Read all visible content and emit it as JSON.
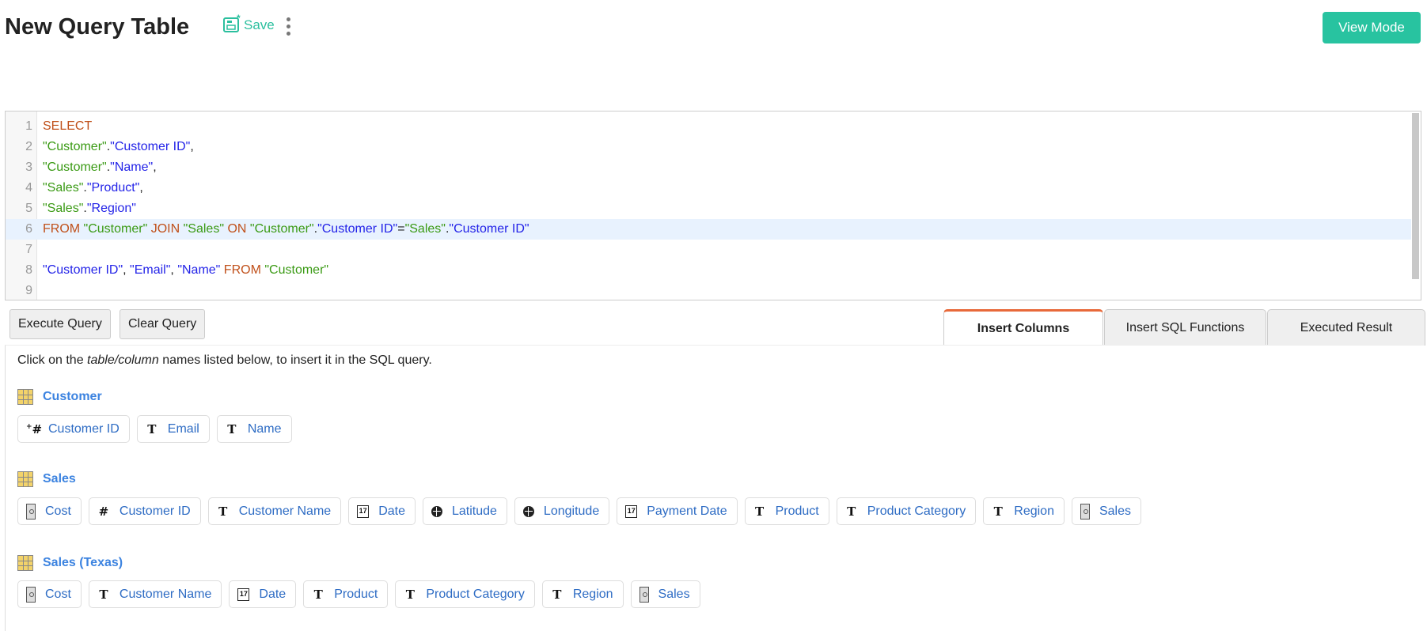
{
  "header": {
    "title": "New Query Table",
    "save_label": "Save",
    "view_mode_label": "View Mode"
  },
  "editor": {
    "lines": [
      {
        "n": "1",
        "tokens": [
          [
            "kw",
            "SELECT"
          ]
        ]
      },
      {
        "n": "2",
        "tokens": [
          [
            "tb",
            "\"Customer\""
          ],
          [
            "pn",
            "."
          ],
          [
            "cl",
            "\"Customer ID\""
          ],
          [
            "pn",
            ","
          ]
        ]
      },
      {
        "n": "3",
        "tokens": [
          [
            "tb",
            "\"Customer\""
          ],
          [
            "pn",
            "."
          ],
          [
            "cl",
            "\"Name\""
          ],
          [
            "pn",
            ","
          ]
        ]
      },
      {
        "n": "4",
        "tokens": [
          [
            "tb",
            "\"Sales\""
          ],
          [
            "pn",
            "."
          ],
          [
            "cl",
            "\"Product\""
          ],
          [
            "pn",
            ","
          ]
        ]
      },
      {
        "n": "5",
        "tokens": [
          [
            "tb",
            "\"Sales\""
          ],
          [
            "pn",
            "."
          ],
          [
            "cl",
            "\"Region\""
          ]
        ]
      },
      {
        "n": "6",
        "tokens": [
          [
            "kw",
            "FROM "
          ],
          [
            "tb",
            "\"Customer\""
          ],
          [
            "kw",
            " JOIN "
          ],
          [
            "tb",
            "\"Sales\""
          ],
          [
            "kw",
            " ON "
          ],
          [
            "tb",
            "\"Customer\""
          ],
          [
            "pn",
            "."
          ],
          [
            "cl",
            "\"Customer ID\""
          ],
          [
            "pn",
            "="
          ],
          [
            "tb",
            "\"Sales\""
          ],
          [
            "pn",
            "."
          ],
          [
            "cl",
            "\"Customer ID\""
          ]
        ]
      },
      {
        "n": "7",
        "tokens": []
      },
      {
        "n": "8",
        "tokens": [
          [
            "cl",
            "\"Customer ID\""
          ],
          [
            "pn",
            ", "
          ],
          [
            "cl",
            "\"Email\""
          ],
          [
            "pn",
            ", "
          ],
          [
            "cl",
            "\"Name\""
          ],
          [
            "kw",
            " FROM "
          ],
          [
            "tb",
            "\"Customer\""
          ]
        ]
      },
      {
        "n": "9",
        "tokens": []
      }
    ]
  },
  "buttons": {
    "execute": "Execute Query",
    "clear": "Clear Query"
  },
  "tabs": [
    "Insert Columns",
    "Insert SQL Functions",
    "Executed Result"
  ],
  "panel": {
    "hint_pre": "Click on the ",
    "hint_em": "table/column",
    "hint_post": " names listed below, to insert it in the SQL query.",
    "groups": [
      {
        "name": "Customer",
        "columns": [
          {
            "icon": "plus-hash",
            "label": "Customer ID"
          },
          {
            "icon": "text",
            "label": "Email"
          },
          {
            "icon": "text",
            "label": "Name"
          }
        ]
      },
      {
        "name": "Sales",
        "columns": [
          {
            "icon": "measure",
            "label": "Cost"
          },
          {
            "icon": "hash",
            "label": "Customer ID"
          },
          {
            "icon": "text",
            "label": "Customer Name"
          },
          {
            "icon": "calendar",
            "label": "Date"
          },
          {
            "icon": "globe",
            "label": "Latitude"
          },
          {
            "icon": "globe",
            "label": "Longitude"
          },
          {
            "icon": "calendar",
            "label": "Payment Date"
          },
          {
            "icon": "text",
            "label": "Product"
          },
          {
            "icon": "text",
            "label": "Product Category"
          },
          {
            "icon": "text",
            "label": "Region"
          },
          {
            "icon": "measure",
            "label": "Sales"
          }
        ]
      },
      {
        "name": "Sales (Texas)",
        "columns": [
          {
            "icon": "measure",
            "label": "Cost"
          },
          {
            "icon": "text",
            "label": "Customer Name"
          },
          {
            "icon": "calendar",
            "label": "Date"
          },
          {
            "icon": "text",
            "label": "Product"
          },
          {
            "icon": "text",
            "label": "Product Category"
          },
          {
            "icon": "text",
            "label": "Region"
          },
          {
            "icon": "measure",
            "label": "Sales"
          }
        ]
      }
    ]
  }
}
